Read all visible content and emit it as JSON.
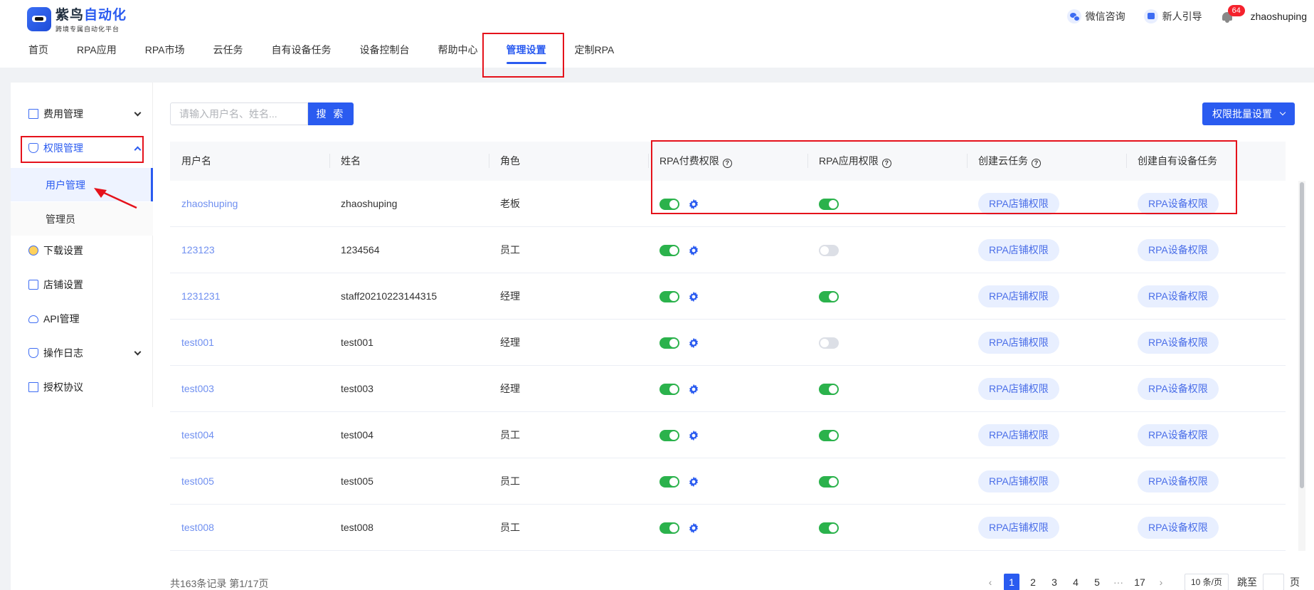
{
  "brand": {
    "title_a": "紫鸟",
    "title_b": "自动化",
    "subtitle": "跨境专属自动化平台"
  },
  "header": {
    "wechat": "微信咨询",
    "guide": "新人引导",
    "notification_count": "64",
    "username": "zhaoshuping"
  },
  "nav": [
    {
      "label": "首页"
    },
    {
      "label": "RPA应用"
    },
    {
      "label": "RPA市场"
    },
    {
      "label": "云任务"
    },
    {
      "label": "自有设备任务"
    },
    {
      "label": "设备控制台"
    },
    {
      "label": "帮助中心"
    },
    {
      "label": "管理设置"
    },
    {
      "label": "定制RPA"
    }
  ],
  "sidebar": {
    "fee": "费用管理",
    "permission": "权限管理",
    "user_mgmt": "用户管理",
    "admin": "管理员",
    "download": "下载设置",
    "store": "店铺设置",
    "api": "API管理",
    "oplog": "操作日志",
    "license": "授权协议"
  },
  "search": {
    "placeholder": "请输入用户名、姓名...",
    "button": "搜 索"
  },
  "batch_button": "权限批量设置",
  "table": {
    "headers": {
      "username": "用户名",
      "name": "姓名",
      "role": "角色",
      "paid": "RPA付费权限",
      "app": "RPA应用权限",
      "cloud": "创建云任务",
      "device": "创建自有设备任务"
    },
    "store_perm_label": "RPA店铺权限",
    "device_perm_label": "RPA设备权限",
    "rows": [
      {
        "username": "zhaoshuping",
        "name": "zhaoshuping",
        "role": "老板",
        "paid": true,
        "app": true
      },
      {
        "username": "123123",
        "name": "1234564",
        "role": "员工",
        "paid": true,
        "app": false
      },
      {
        "username": "1231231",
        "name": "staff20210223144315",
        "role": "经理",
        "paid": true,
        "app": true
      },
      {
        "username": "test001",
        "name": "test001",
        "role": "经理",
        "paid": true,
        "app": false
      },
      {
        "username": "test003",
        "name": "test003",
        "role": "经理",
        "paid": true,
        "app": true
      },
      {
        "username": "test004",
        "name": "test004",
        "role": "员工",
        "paid": true,
        "app": true
      },
      {
        "username": "test005",
        "name": "test005",
        "role": "员工",
        "paid": true,
        "app": true
      },
      {
        "username": "test008",
        "name": "test008",
        "role": "员工",
        "paid": true,
        "app": true
      }
    ]
  },
  "pagination": {
    "total": "共163条记录 第1/17页",
    "pages": [
      "1",
      "2",
      "3",
      "4",
      "5"
    ],
    "ellipsis": "···",
    "last": "17",
    "page_size": "10 条/页",
    "jump_prefix": "跳至",
    "jump_suffix": "页",
    "current": 1
  },
  "colors": {
    "primary": "#2a5bf0",
    "switch_on": "#2bb24c",
    "highlight": "#e5121b"
  }
}
